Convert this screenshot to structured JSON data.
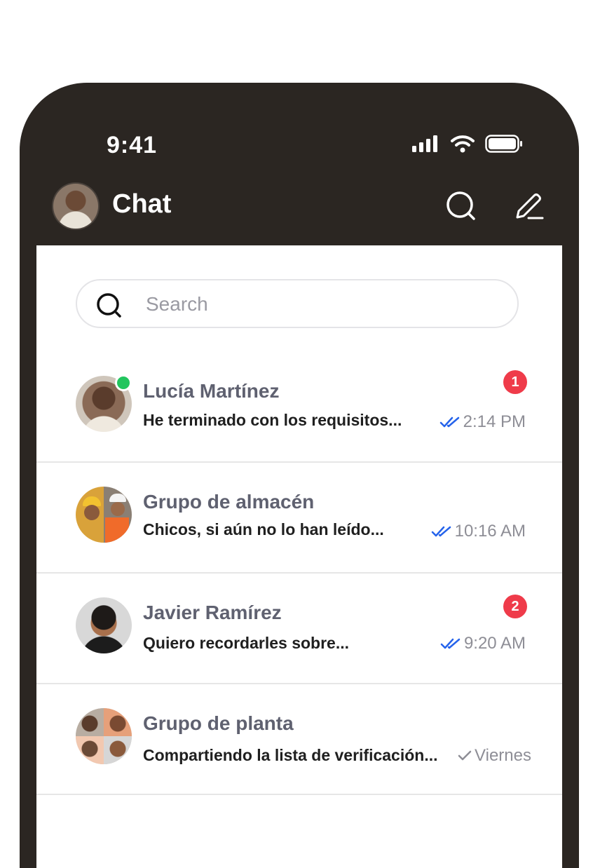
{
  "status_bar": {
    "time": "9:41"
  },
  "header": {
    "title": "Chat"
  },
  "search": {
    "placeholder": "Search"
  },
  "chats": [
    {
      "name": "Lucía Martínez",
      "preview": "He terminado con los requisitos...",
      "time": "2:14 PM",
      "unread": "1",
      "online": true,
      "read_receipt": "double-check-icon"
    },
    {
      "name": "Grupo de almacén",
      "preview": "Chicos, si aún no lo han leído...",
      "time": "10:16 AM",
      "read_receipt": "double-check-icon"
    },
    {
      "name": "Javier Ramírez",
      "preview": "Quiero recordarles sobre...",
      "time": "9:20 AM",
      "unread": "2",
      "read_receipt": "double-check-icon"
    },
    {
      "name": "Grupo de planta",
      "preview": "Compartiendo la lista de verificación...",
      "time": "Viernes",
      "read_receipt": "single-check-icon"
    }
  ],
  "colors": {
    "frame": "#2b2622",
    "badge": "#ef3b4a",
    "online": "#22c55e",
    "read_check": "#2563eb"
  }
}
